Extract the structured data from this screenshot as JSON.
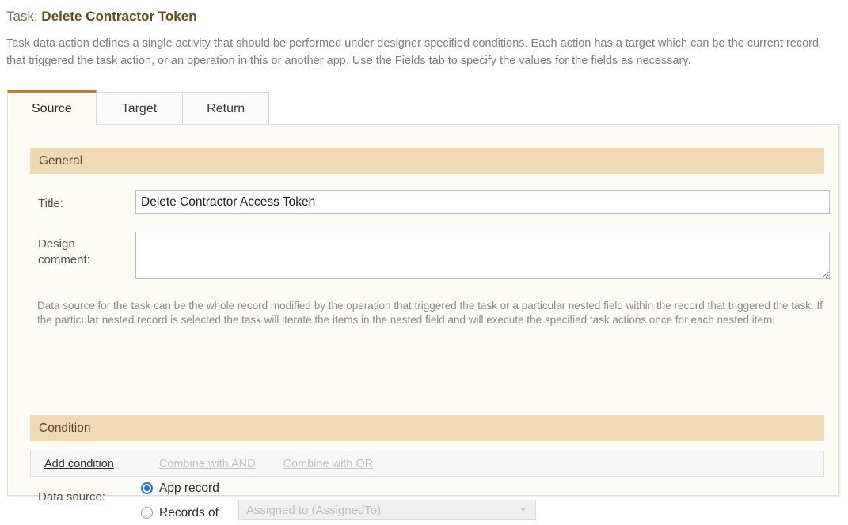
{
  "header": {
    "task_label": "Task:",
    "task_name": "Delete Contractor Token",
    "intro": "Task data action defines a single activity that should be performed under designer specified conditions. Each action has a target which can be the current record that triggered the task action, or an operation in this or another app. Use the Fields tab to specify the values for the fields as necessary."
  },
  "tabs": [
    {
      "label": "Source",
      "active": true
    },
    {
      "label": "Target",
      "active": false
    },
    {
      "label": "Return",
      "active": false
    }
  ],
  "general": {
    "section_title": "General",
    "title_label": "Title:",
    "title_value": "Delete Contractor Access Token",
    "title_placeholder": "",
    "comment_label": "Design comment:",
    "comment_value": "",
    "comment_placeholder": "",
    "datasource_description": "Data source for the task can be the whole record modified by the operation that triggered the task or a particular nested field within the record that triggered the task. If the particular nested record is selected the task will iterate the items in the nested field and will execute the specified task actions once for each nested item.",
    "datasource_label": "Data source:",
    "radio_app_record": "App record",
    "radio_records_of": "Records of",
    "records_of_selected": "Assigned to (AssignedTo)"
  },
  "condition": {
    "section_title": "Condition",
    "add_condition": "Add condition",
    "combine_and": "Combine with AND",
    "combine_or": "Combine with OR"
  },
  "colors": {
    "accent": "#b5823a",
    "section_header": "#f2d8b5",
    "panel_background": "#fdfbf5",
    "radio_selected": "#1a73e8",
    "title_name": "#6b4a16"
  }
}
